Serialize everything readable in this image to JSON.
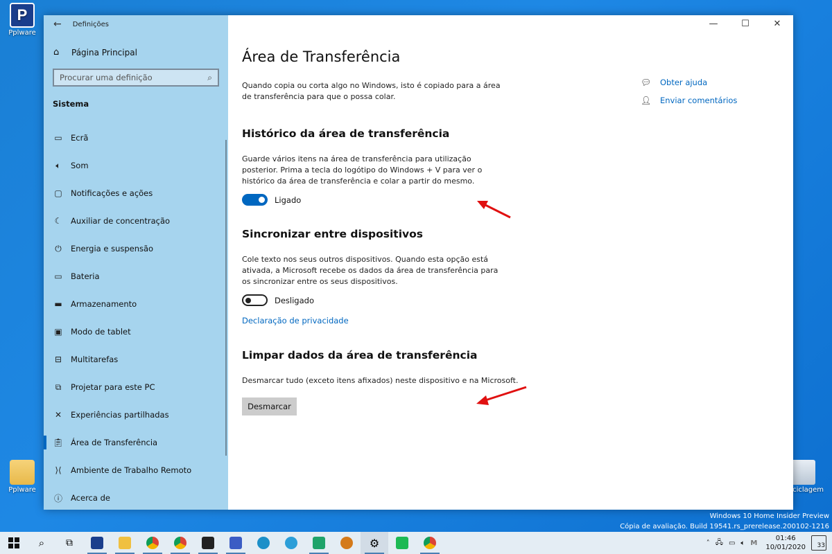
{
  "desktop": {
    "icons": [
      {
        "label": "Pplware"
      },
      {
        "label": "Pplware"
      },
      {
        "label": "Reciclagem"
      }
    ]
  },
  "window": {
    "app_title": "Definições",
    "controls": {
      "minimize": "—",
      "maximize": "☐",
      "close": "✕"
    }
  },
  "sidebar": {
    "home_label": "Página Principal",
    "search_placeholder": "Procurar uma definição",
    "section_label": "Sistema",
    "items": [
      {
        "label": "Ecrã",
        "icon": "monitor-icon"
      },
      {
        "label": "Som",
        "icon": "speaker-icon"
      },
      {
        "label": "Notificações e ações",
        "icon": "notification-icon"
      },
      {
        "label": "Auxiliar de concentração",
        "icon": "moon-icon"
      },
      {
        "label": "Energia e suspensão",
        "icon": "power-icon"
      },
      {
        "label": "Bateria",
        "icon": "battery-icon"
      },
      {
        "label": "Armazenamento",
        "icon": "storage-icon"
      },
      {
        "label": "Modo de tablet",
        "icon": "tablet-icon"
      },
      {
        "label": "Multitarefas",
        "icon": "multitask-icon"
      },
      {
        "label": "Projetar para este PC",
        "icon": "project-icon"
      },
      {
        "label": "Experiências partilhadas",
        "icon": "shared-icon"
      },
      {
        "label": "Área de Transferência",
        "icon": "clipboard-icon",
        "active": true
      },
      {
        "label": "Ambiente de Trabalho Remoto",
        "icon": "remote-icon"
      },
      {
        "label": "Acerca de",
        "icon": "info-icon"
      }
    ]
  },
  "main": {
    "title": "Área de Transferência",
    "intro": "Quando copia ou corta algo no Windows, isto é copiado para a área de transferência para que o possa colar.",
    "history": {
      "heading": "Histórico da área de transferência",
      "description": "Guarde vários itens na área de transferência para utilização posterior. Prima a tecla do logótipo do Windows + V para ver o histórico da área de transferência e colar a partir do mesmo.",
      "toggle_state": "Ligado"
    },
    "sync": {
      "heading": "Sincronizar entre dispositivos",
      "description": "Cole texto nos seus outros dispositivos. Quando esta opção está ativada, a Microsoft recebe os dados da área de transferência para os sincronizar entre os seus dispositivos.",
      "toggle_state": "Desligado",
      "privacy_link": "Declaração de privacidade"
    },
    "clear": {
      "heading": "Limpar dados da área de transferência",
      "description": "Desmarcar tudo (exceto itens afixados) neste dispositivo e na Microsoft.",
      "button": "Desmarcar"
    },
    "help": {
      "get_help": "Obter ajuda",
      "feedback": "Enviar comentários"
    }
  },
  "watermark": {
    "line1": "Windows 10 Home Insider Preview",
    "line2": "Cópia de avaliação. Build 19541.rs_prerelease.200102-1216"
  },
  "taskbar": {
    "clock_time": "01:46",
    "clock_date": "10/01/2020",
    "notification_count": "33",
    "colors": {
      "accent": "#0067c0",
      "arrow": "#e01010",
      "sidebar_bg": "#a6d4ee"
    }
  }
}
